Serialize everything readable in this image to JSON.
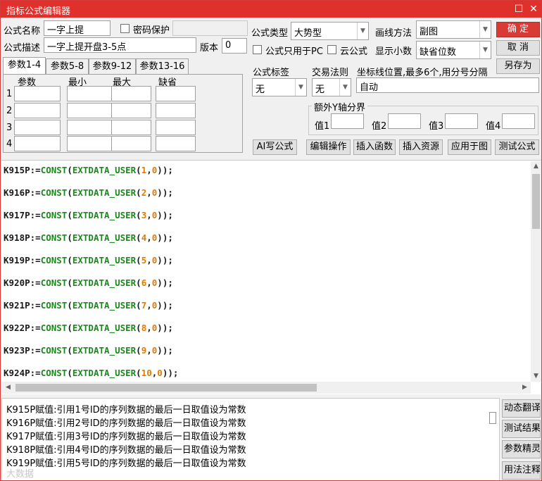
{
  "window": {
    "title": "指标公式编辑器",
    "maximize_glyph": "☐",
    "close_glyph": "✕"
  },
  "form": {
    "name_label": "公式名称",
    "name_value": "一字上提",
    "password_label": "密码保护",
    "desc_label": "公式描述",
    "desc_value": "一字上提开盘3-5点",
    "version_label": "版本",
    "version_value": "0",
    "type_label": "公式类型",
    "type_value": "大势型",
    "draw_label": "画线方法",
    "draw_value": "副图",
    "pc_only_label": "公式只用于PC",
    "cloud_label": "云公式",
    "decimals_label": "显示小数",
    "decimals_value": "缺省位数",
    "tag_label": "公式标签",
    "tag_value": "无",
    "trade_label": "交易法则",
    "trade_value": "无",
    "coord_label": "坐标线位置,最多6个,用分号分隔",
    "coord_value": "自动",
    "extra_y_title": "额外Y轴分界",
    "extra_y": [
      "值1",
      "值2",
      "值3",
      "值4"
    ]
  },
  "buttons": {
    "ok": "确  定",
    "cancel": "取  消",
    "save_as": "另存为",
    "ai": "AI写公式",
    "edit_ops": "编辑操作",
    "insert_fn": "插入函数",
    "insert_res": "插入资源",
    "apply": "应用于图",
    "test": "测试公式"
  },
  "tabs": [
    "参数1-4",
    "参数5-8",
    "参数9-12",
    "参数13-16"
  ],
  "param_table": {
    "headers": [
      "参数",
      "最小",
      "最大",
      "缺省"
    ],
    "rows": [
      "1",
      "2",
      "3",
      "4"
    ]
  },
  "code_lines": [
    {
      "var": "K915P",
      "n": "1"
    },
    {
      "var": "K916P",
      "n": "2"
    },
    {
      "var": "K917P",
      "n": "3"
    },
    {
      "var": "K918P",
      "n": "4"
    },
    {
      "var": "K919P",
      "n": "5"
    },
    {
      "var": "K920P",
      "n": "6"
    },
    {
      "var": "K921P",
      "n": "7"
    },
    {
      "var": "K922P",
      "n": "8"
    },
    {
      "var": "K923P",
      "n": "9"
    },
    {
      "var": "K924P",
      "n": "10"
    }
  ],
  "code_tokens": {
    "assign": ":=",
    "fn1": "CONST",
    "fn2": "EXTDATA_USER",
    "zero": "0",
    "close": "));"
  },
  "notes": [
    "K915P赋值:引用1号ID的序列数据的最后一日取值设为常数",
    "K916P赋值:引用2号ID的序列数据的最后一日取值设为常数",
    "K917P赋值:引用3号ID的序列数据的最后一日取值设为常数",
    "K918P赋值:引用4号ID的序列数据的最后一日取值设为常数",
    "K919P赋值:引用5号ID的序列数据的最后一日取值设为常数"
  ],
  "side_buttons": [
    "动态翻译",
    "测试结果",
    "参数精灵",
    "用法注释"
  ],
  "watermark": "大数据",
  "colors": {
    "title_bar": "#e0302c",
    "code_function": "#1a8a1a",
    "code_number": "#e07b00"
  }
}
